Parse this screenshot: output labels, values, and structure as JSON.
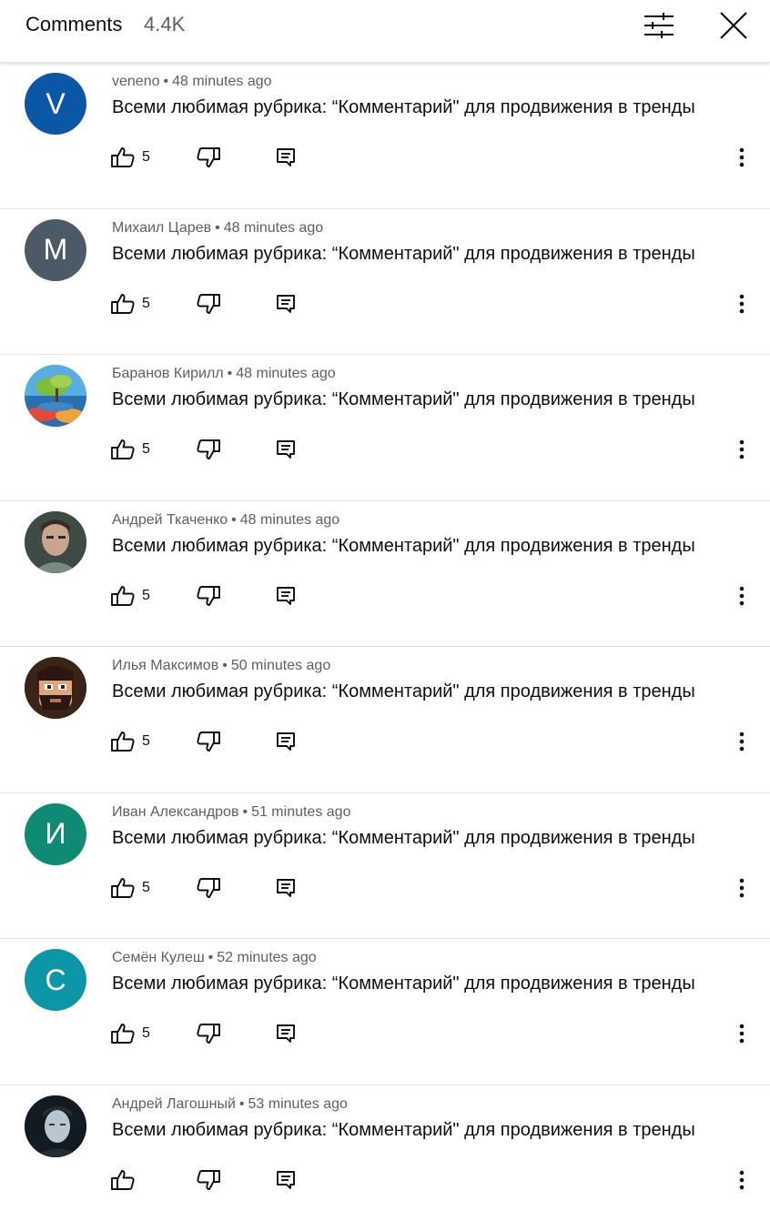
{
  "header": {
    "title": "Comments",
    "count": "4.4K"
  },
  "comments": [
    {
      "author": "veneno",
      "time": "48 minutes ago",
      "text": "Всеми любимая рубрика: “Комментарий\" для продвижения в тренды",
      "likes": "5",
      "avatar_letter": "V",
      "avatar_color": "#0b56a5",
      "avatar_kind": "letter"
    },
    {
      "author": "Михаил Царев",
      "time": "48 minutes ago",
      "text": "Всеми любимая рубрика: “Комментарий\" для продвижения в тренды",
      "likes": "5",
      "avatar_letter": "M",
      "avatar_color": "#4a5a66",
      "avatar_kind": "letter"
    },
    {
      "author": "Баранов Кирилл",
      "time": "48 minutes ago",
      "text": "Всеми любимая рубрика: “Комментарий\" для продвижения в тренды",
      "likes": "5",
      "avatar_letter": "",
      "avatar_color": "#4aa0d8",
      "avatar_kind": "landscape"
    },
    {
      "author": "Андрей Ткаченко",
      "time": "48 minutes ago",
      "text": "Всеми любимая рубрика: “Комментарий\" для продвижения в тренды",
      "likes": "5",
      "avatar_letter": "",
      "avatar_color": "#5c6b62",
      "avatar_kind": "photo"
    },
    {
      "author": "Илья Максимов",
      "time": "50 minutes ago",
      "text": "Всеми любимая рубрика: “Комментарий\" для продвижения в тренды",
      "likes": "5",
      "avatar_letter": "",
      "avatar_color": "#4a2a1a",
      "avatar_kind": "cartoon"
    },
    {
      "author": "Иван Александров",
      "time": "51 minutes ago",
      "text": "Всеми любимая рубрика: “Комментарий\" для продвижения в тренды",
      "likes": "5",
      "avatar_letter": "И",
      "avatar_color": "#0f8a73",
      "avatar_kind": "letter"
    },
    {
      "author": "Семён Кулеш",
      "time": "52 minutes ago",
      "text": "Всеми любимая рубрика: “Комментарий\" для продвижения в тренды",
      "likes": "5",
      "avatar_letter": "С",
      "avatar_color": "#0d96a8",
      "avatar_kind": "letter"
    },
    {
      "author": "Андрей Лагошный",
      "time": "53 minutes ago",
      "text": "Всеми любимая рубрика: “Комментарий\" для продвижения в тренды",
      "likes": "",
      "avatar_letter": "",
      "avatar_color": "#1d2b36",
      "avatar_kind": "dark"
    }
  ]
}
